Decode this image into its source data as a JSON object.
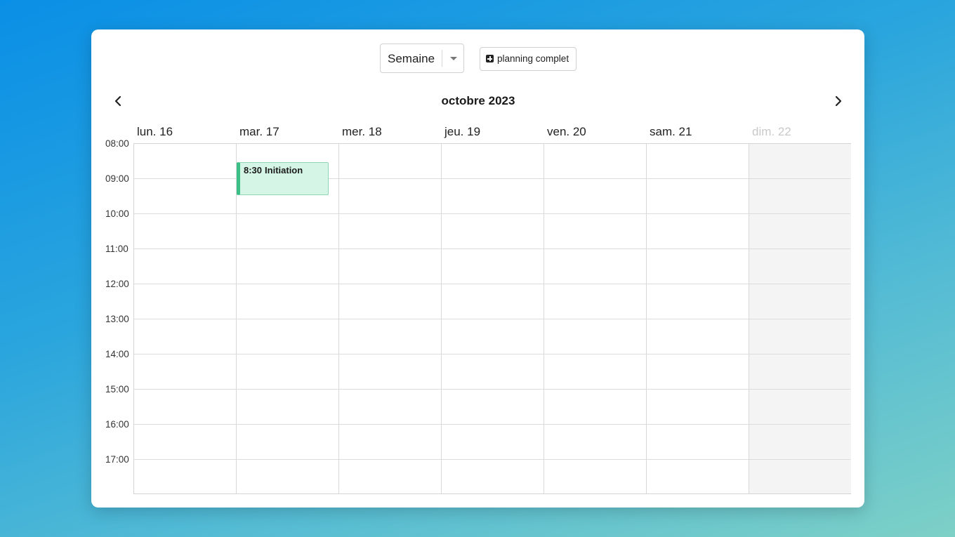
{
  "toolbar": {
    "view_value": "Semaine",
    "full_planning_label": "planning complet"
  },
  "nav": {
    "month_title": "octobre 2023",
    "prev_icon": "chevron-left-icon",
    "next_icon": "chevron-right-icon"
  },
  "days": [
    {
      "label": "lun. 16"
    },
    {
      "label": "mar. 17"
    },
    {
      "label": "mer. 18"
    },
    {
      "label": "jeu. 19"
    },
    {
      "label": "ven. 20"
    },
    {
      "label": "sam. 21"
    },
    {
      "label": "dim. 22",
      "disabled": true
    }
  ],
  "times": [
    "08:00",
    "09:00",
    "10:00",
    "11:00",
    "12:00",
    "13:00",
    "14:00",
    "15:00",
    "16:00",
    "17:00"
  ],
  "event": {
    "time": "8:30",
    "title": "Initiation",
    "day": "mar. 17",
    "color": "#3bbf86",
    "background": "#d5f5e6"
  }
}
